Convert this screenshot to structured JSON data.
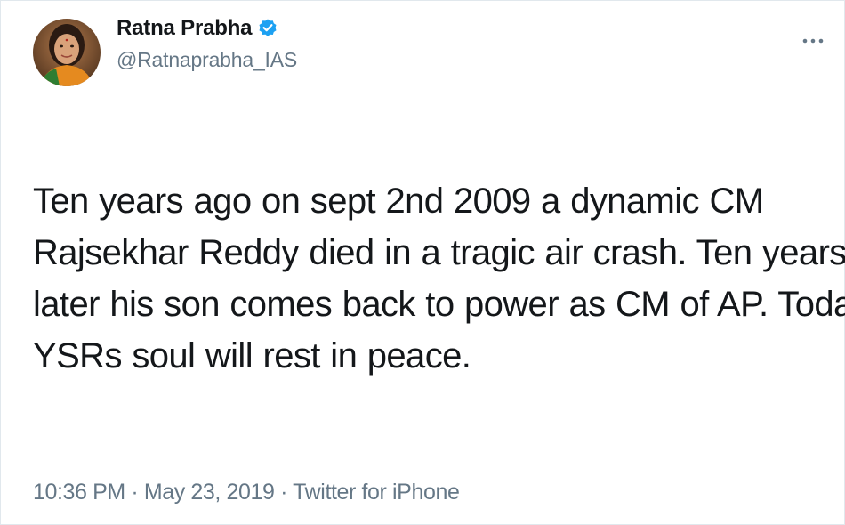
{
  "tweet": {
    "author": {
      "display_name": "Ratna Prabha",
      "handle": "@Ratnaprabha_IAS",
      "verified": true
    },
    "text_lines": [
      "Ten years ago on sept 2nd 2009 a dynamic CM",
      "Rajsekhar Reddy died in a tragic air crash. Ten years",
      "later his son comes back to power as CM of AP. Today",
      "YSRs soul will rest in peace."
    ],
    "meta": {
      "time": "10:36 PM",
      "separator": "·",
      "date": "May 23, 2019",
      "source": "Twitter for iPhone"
    },
    "icons": {
      "more": "more-dots-icon",
      "verified": "verified-badge-icon"
    }
  },
  "colors": {
    "verified_blue": "#1da1f2",
    "secondary_text": "#657786",
    "primary_text": "#14171a"
  }
}
